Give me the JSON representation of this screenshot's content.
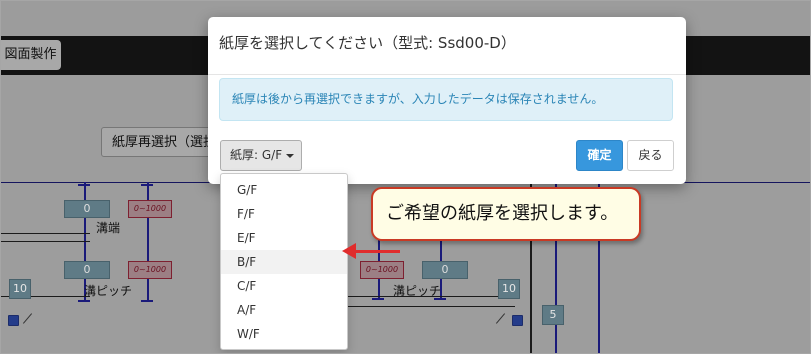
{
  "background": {
    "toolbar_button": "図面製作",
    "reselect_button": "紙厚再選択（選択",
    "labels": {
      "groove_end": "溝端",
      "groove_pitch_left": "溝ピッチ",
      "groove_pitch_right": "溝ピッチ"
    },
    "values": {
      "left_top": "0",
      "left_mid": "0",
      "right_mid": "0",
      "left_square": "10",
      "right_square": "10",
      "right_bottom_square": "5",
      "range_left_top": "0~1000",
      "range_left_mid": "0~1000",
      "range_right_mid": "0~1000"
    }
  },
  "modal": {
    "title": "紙厚を選択してください（型式: Ssd00-D）",
    "alert": "紙厚は後から再選択できますが、入力したデータは保存されません。",
    "dropdown_label": "紙厚: G/F",
    "confirm_label": "確定",
    "back_label": "戻る"
  },
  "dropdown_menu": {
    "items": [
      "G/F",
      "F/F",
      "E/F",
      "B/F",
      "C/F",
      "A/F",
      "W/F"
    ],
    "highlighted": "B/F"
  },
  "annotation": {
    "callout_text": "ご希望の紙厚を選択します。"
  },
  "colors": {
    "confirm": "#3797dd",
    "alert_text": "#2a85b6",
    "callout_border": "#c93a24",
    "arrow": "#e02c2c"
  }
}
